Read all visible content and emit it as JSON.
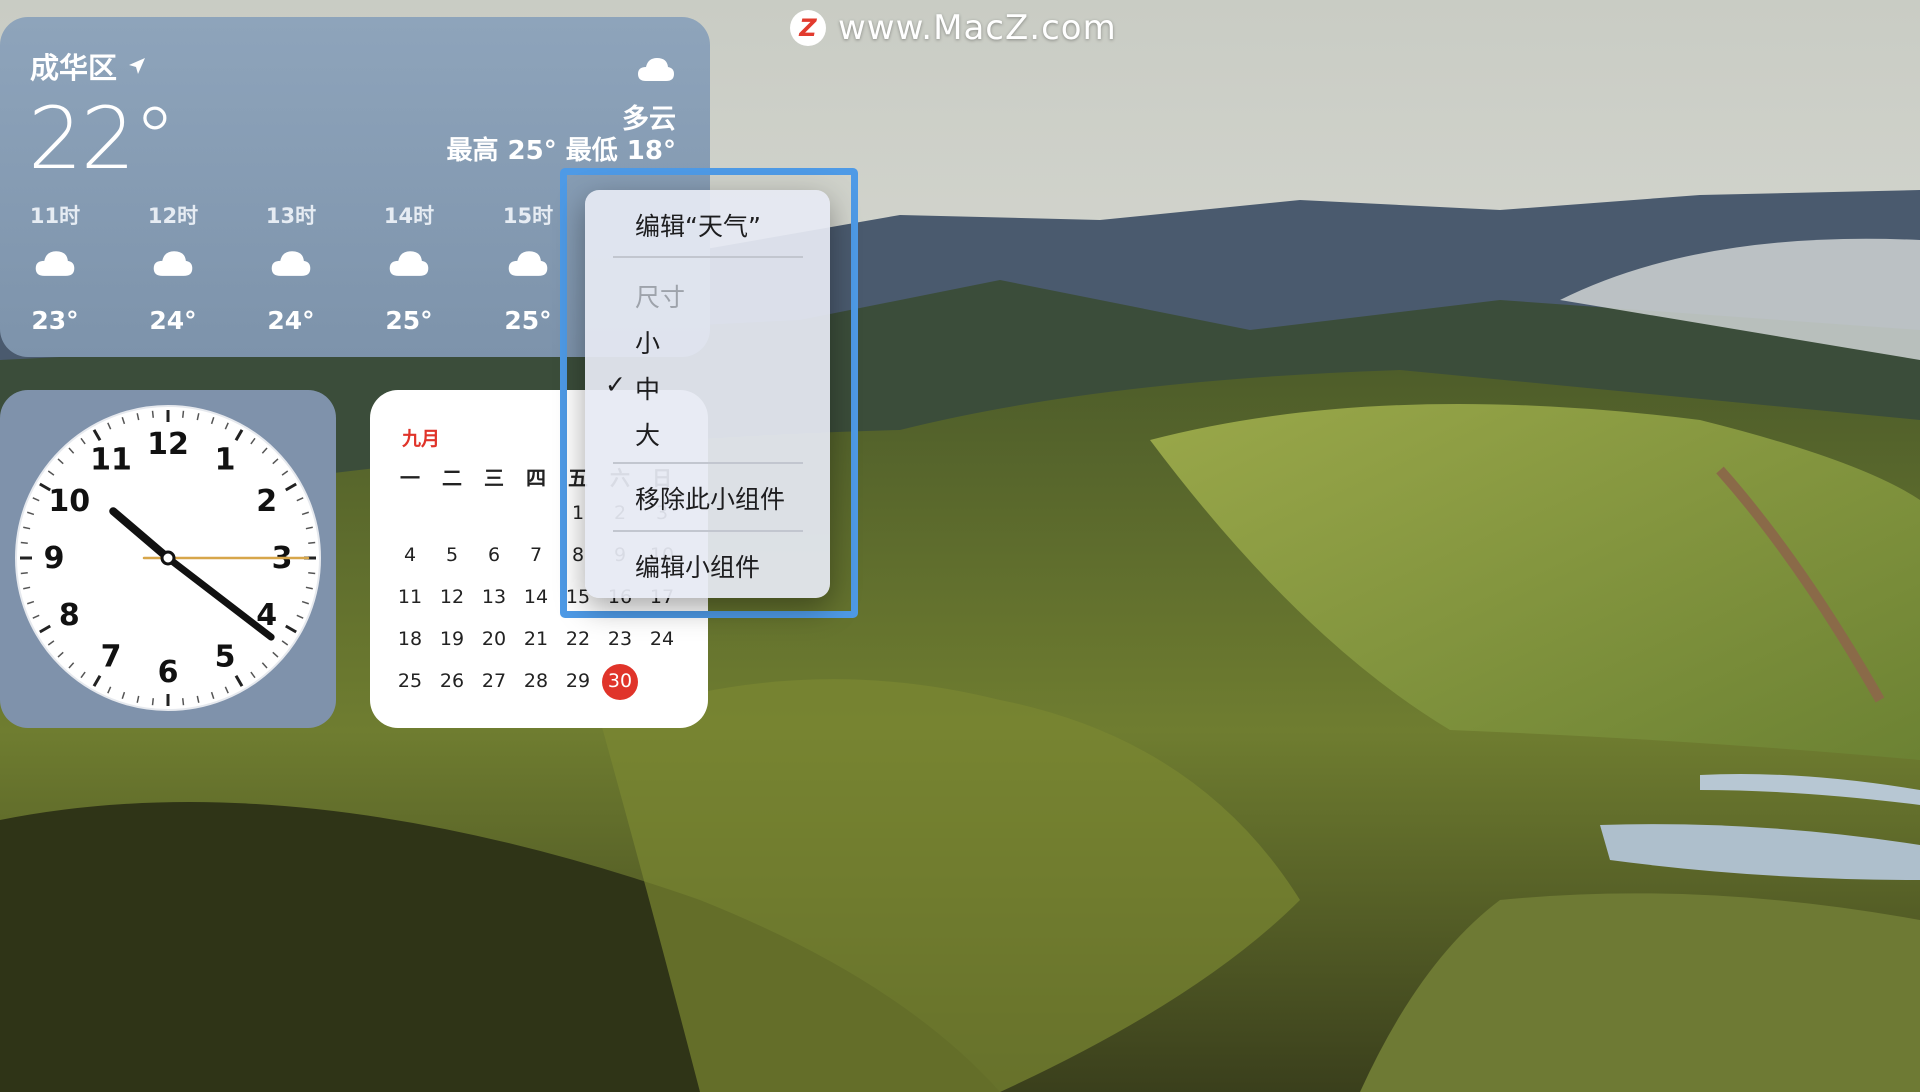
{
  "watermark": {
    "text": "www.MacZ.com",
    "logo": "Z"
  },
  "weather": {
    "location": "成华区",
    "temperature": "22°",
    "condition": "多云",
    "high_low": "最高 25° 最低 18°",
    "hourly": [
      {
        "time": "11时",
        "temp": "23°",
        "icon": "cloud-icon"
      },
      {
        "time": "12时",
        "temp": "24°",
        "icon": "cloud-icon"
      },
      {
        "time": "13时",
        "temp": "24°",
        "icon": "cloud-icon"
      },
      {
        "time": "14时",
        "temp": "25°",
        "icon": "cloud-icon"
      },
      {
        "time": "15时",
        "temp": "25°",
        "icon": "cloud-icon"
      }
    ]
  },
  "clock": {
    "numbers": [
      "12",
      "1",
      "2",
      "3",
      "4",
      "5",
      "6",
      "7",
      "8",
      "9",
      "10",
      "11"
    ],
    "time": {
      "hour": 10,
      "minute": 21,
      "second": 15
    }
  },
  "calendar": {
    "month": "九月",
    "weekdays": [
      "一",
      "二",
      "三",
      "四",
      "五",
      "六",
      "日"
    ],
    "weeks": [
      [
        "",
        "",
        "",
        "",
        "1",
        "2",
        "3"
      ],
      [
        "4",
        "5",
        "6",
        "7",
        "8",
        "9",
        "10"
      ],
      [
        "11",
        "12",
        "13",
        "14",
        "15",
        "16",
        "17"
      ],
      [
        "18",
        "19",
        "20",
        "21",
        "22",
        "23",
        "24"
      ],
      [
        "25",
        "26",
        "27",
        "28",
        "29",
        "30",
        ""
      ]
    ],
    "today": "30"
  },
  "menu": {
    "edit_weather": "编辑“天气”",
    "size_header": "尺寸",
    "size_small": "小",
    "size_medium": "中",
    "size_large": "大",
    "checkmark": "✓",
    "remove": "移除此小组件",
    "edit_widgets": "编辑小组件"
  },
  "colors": {
    "accent_red": "#e0342a",
    "selection_blue": "#4e9ae6"
  }
}
